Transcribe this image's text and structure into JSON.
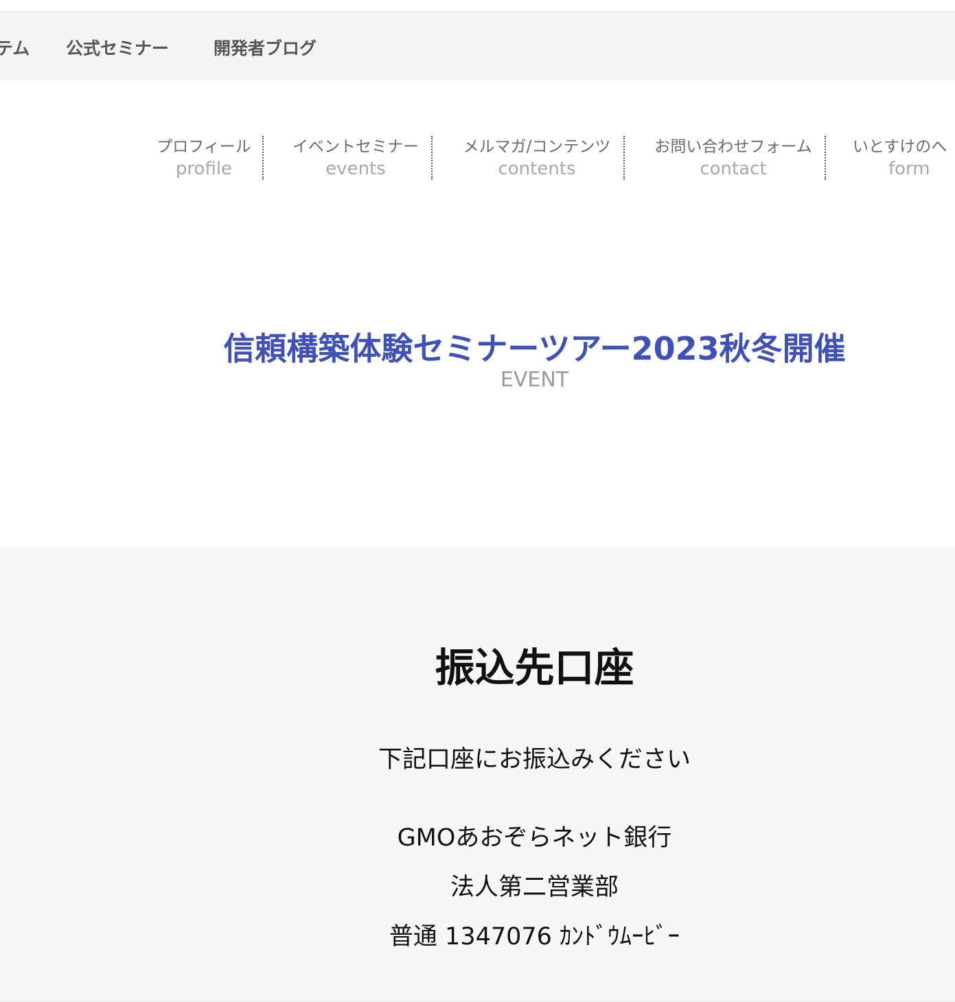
{
  "top_nav": {
    "items": [
      "テム",
      "公式セミナー",
      "開発者ブログ"
    ]
  },
  "global_nav": {
    "items": [
      {
        "jp": "プロフィール",
        "en": "profile"
      },
      {
        "jp": "イベントセミナー",
        "en": "events"
      },
      {
        "jp": "メルマガ/コンテンツ",
        "en": "contents"
      },
      {
        "jp": "お問い合わせフォーム",
        "en": "contact"
      },
      {
        "jp": "いとすけのへ",
        "en": "form"
      }
    ]
  },
  "event": {
    "title": "信頼構築体験セミナーツアー2023秋冬開催",
    "subtitle": "EVENT"
  },
  "bank": {
    "heading": "振込先口座",
    "note": "下記口座にお振込みください",
    "bank_name": "GMOあおぞらネット銀行",
    "branch": "法人第二営業部",
    "account": "普通 1347076 ｶﾝﾄﾞｳﾑｰﾋﾞｰ"
  },
  "colors": {
    "title_accent": "#3f51b5",
    "nav_bg": "#f4f4f4",
    "section_bg": "#f7f7f7"
  }
}
